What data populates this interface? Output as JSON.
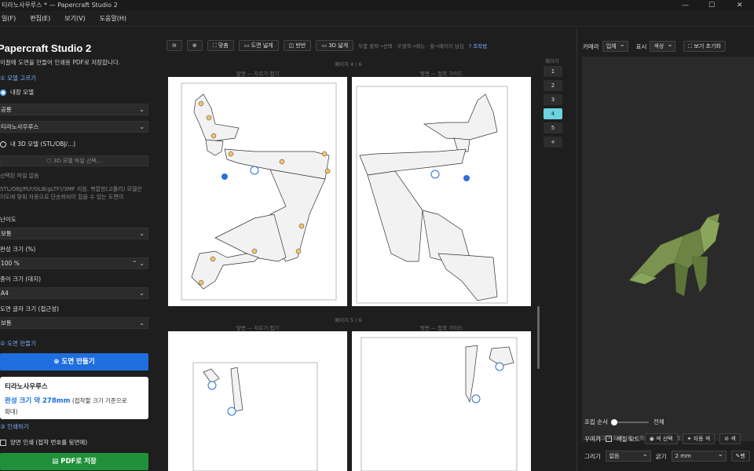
{
  "window": {
    "title": "티라노사우루스 * — Papercraft Studio 2",
    "min": "—",
    "max": "☐",
    "close": "✕"
  },
  "menu": [
    "일(F)",
    "편집(E)",
    "보기(V)",
    "도움말(H)"
  ],
  "left": {
    "app_title": "Papercraft Studio 2",
    "description": "이끌에 도면을 만들어 인쇄용 PDF로 저장합니다.",
    "section_model": "① 모델 고르기",
    "builtin_model": "내장 모델",
    "category": "공룡",
    "model": "티라노사우루스",
    "my_model": "내 3D 모델 (STL/OBJ/...)",
    "file_button": "3D 모델 파일 선택...",
    "no_file": "선택된 파일 없음",
    "support_note_1": "STL/OBJ/PLY/GLB(gLTF)/3MF 지원. 복잡한(고폴리) 모델은",
    "support_note_2": "이도에 맞춰 자동으로 단순화되어 접을 수 있는 도면이",
    "difficulty_label": "난이도",
    "difficulty": "보통",
    "size_label": "완성 크기 (%)",
    "size": "100 %",
    "paper_label": "종이 크기 (대지)",
    "paper": "A4",
    "font_label": "도면 글자 크기 (접근성)",
    "font": "보통",
    "section_make": "② 도면 만들기",
    "make_button": "도면 만들기",
    "card_title": "티라노사우루스",
    "card_size_prefix": "완성 크기 약 ",
    "card_size_value": "278mm",
    "card_size_suffix": " (접착할 크기 기준으로",
    "card_size_suffix2": "확대)",
    "section_print": "③ 인쇄하기",
    "duplex": "양면 인쇄 (접착 번호를 뒷면에)",
    "pdf_button": "PDF로 저장"
  },
  "center": {
    "toolbar": [
      "맞춤",
      "도면 넓게",
      "반반",
      "3D 넓게"
    ],
    "hint": "부품 클릭→선택 · 우클릭→메뉴 · 휠→페이지 넘김",
    "help": "? 조작법",
    "page4": "페이지 4 / 6",
    "page5": "페이지 5 / 6",
    "front": "앞면 — 자르기·접기",
    "back": "뒷면 — 접착 가이드",
    "page_nav_label": "페이지",
    "pages": [
      "1",
      "2",
      "3",
      "4",
      "5",
      "+"
    ],
    "active_page": "4"
  },
  "right": {
    "camera_label": "카메라",
    "camera": "입체",
    "display_label": "표시",
    "display": "색상",
    "reset_view": "보기 초기화",
    "viewport_hint": "드래그 = 회전 · 휠 = 확대/축소 · 한 클릭 = 부품 선택",
    "assembly_label": "조립 순서",
    "assembly_value": "전체",
    "decorate_label": "꾸미기",
    "color_mode": "색칠 모드",
    "pick_color": "색 선택",
    "auto_color": "자동 색",
    "clear_color": "색",
    "draw_label": "그리기",
    "draw": "없음",
    "thickness_label": "굵기",
    "thickness": "2 mm",
    "pen": "펜"
  },
  "colors": {
    "accent": "#1e6ee0",
    "pdf": "#20913a",
    "model": "#6f8a47",
    "active_page": "#6dd3e0"
  }
}
